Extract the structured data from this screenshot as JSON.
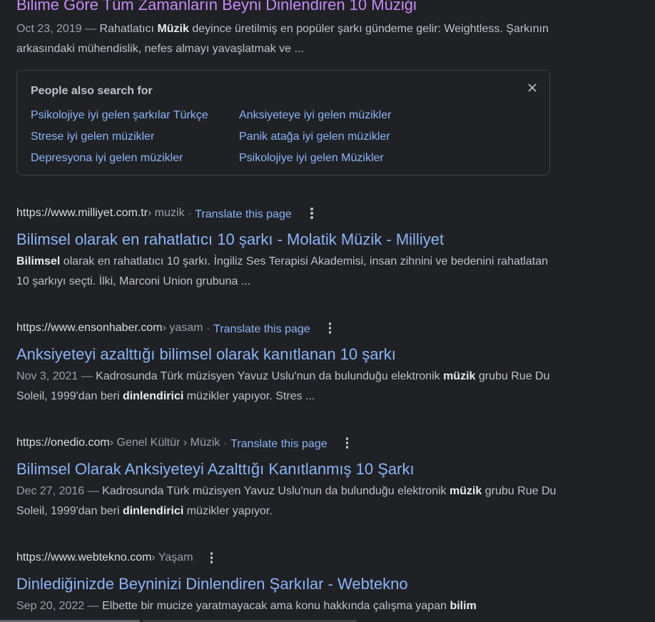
{
  "top_result": {
    "title": "Bilime Göre Tüm Zamanların Beyni Dinlendiren 10 Müziği",
    "date": "Oct 23, 2019",
    "dash": " — ",
    "snippet_parts": [
      "Rahatlatıcı ",
      "Müzik",
      " deyince üretilmiş en popüler şarkı gündeme gelir: Weightless. Şarkının arkasındaki mühendislik, nefes almayı yavaşlatmak ve ..."
    ]
  },
  "people_also_search": {
    "title": "People also search for",
    "close_icon": "close-icon",
    "links": [
      "Psikolojiye iyi gelen şarkılar Türkçe",
      "Anksiyeteye iyi gelen müzikler",
      "Strese iyi gelen müzikler",
      "Panik atağa iyi gelen müzikler",
      "Depresyona iyi gelen müzikler",
      "Psikolojiye iyi gelen Müzikler"
    ]
  },
  "results": [
    {
      "domain": "https://www.milliyet.com.tr",
      "path": " › muzik",
      "translate": "Translate this page",
      "title": "Bilimsel olarak en rahatlatıcı 10 şarkı - Molatik Müzik - Milliyet",
      "date": "",
      "snippet_parts": [
        "Bilimsel",
        " olarak en rahatlatıcı 10 şarkı. İngiliz Ses Terapisi Akademisi, insan zihnini ve bedenini rahatlatan 10 şarkıyı seçti. İlki, Marconi Union grubuna ..."
      ]
    },
    {
      "domain": "https://www.ensonhaber.com",
      "path": " › yasam",
      "translate": "Translate this page",
      "title": "Anksiyeteyi azalttığı bilimsel olarak kanıtlanan 10 şarkı",
      "date": "Nov 3, 2021",
      "snippet_parts": [
        "Kadrosunda Türk müzisyen Yavuz Uslu'nun da bulunduğu elektronik ",
        "müzik",
        " grubu Rue Du Soleil, 1999'dan beri ",
        "dinlendirici",
        " müzikler yapıyor. Stres ..."
      ]
    },
    {
      "domain": "https://onedio.com",
      "path": " › Genel Kültür › Müzik",
      "translate": "Translate this page",
      "title": "Bilimsel Olarak Anksiyeteyi Azalttığı Kanıtlanmış 10 Şarkı",
      "date": "Dec 27, 2016",
      "snippet_parts": [
        "Kadrosunda Türk müzisyen Yavuz Uslu'nun da bulunduğu elektronik ",
        "müzik",
        " grubu Rue Du Soleil, 1999'dan beri ",
        "dinlendirici",
        " müzikler yapıyor."
      ]
    },
    {
      "domain": "https://www.webtekno.com",
      "path": " › Yaşam",
      "translate": "",
      "title": "Dinlediğinizde Beyninizi Dinlendiren Şarkılar - Webtekno",
      "date": "Sep 20, 2022",
      "snippet_parts": [
        "Elbette bir mucize yaratmayacak ama konu hakkında çalışma yapan ",
        "bilim"
      ]
    }
  ],
  "colors": {
    "background": "#202124",
    "link": "#8ab4f8",
    "visited": "#c58af9",
    "text": "#bdc1c6"
  }
}
